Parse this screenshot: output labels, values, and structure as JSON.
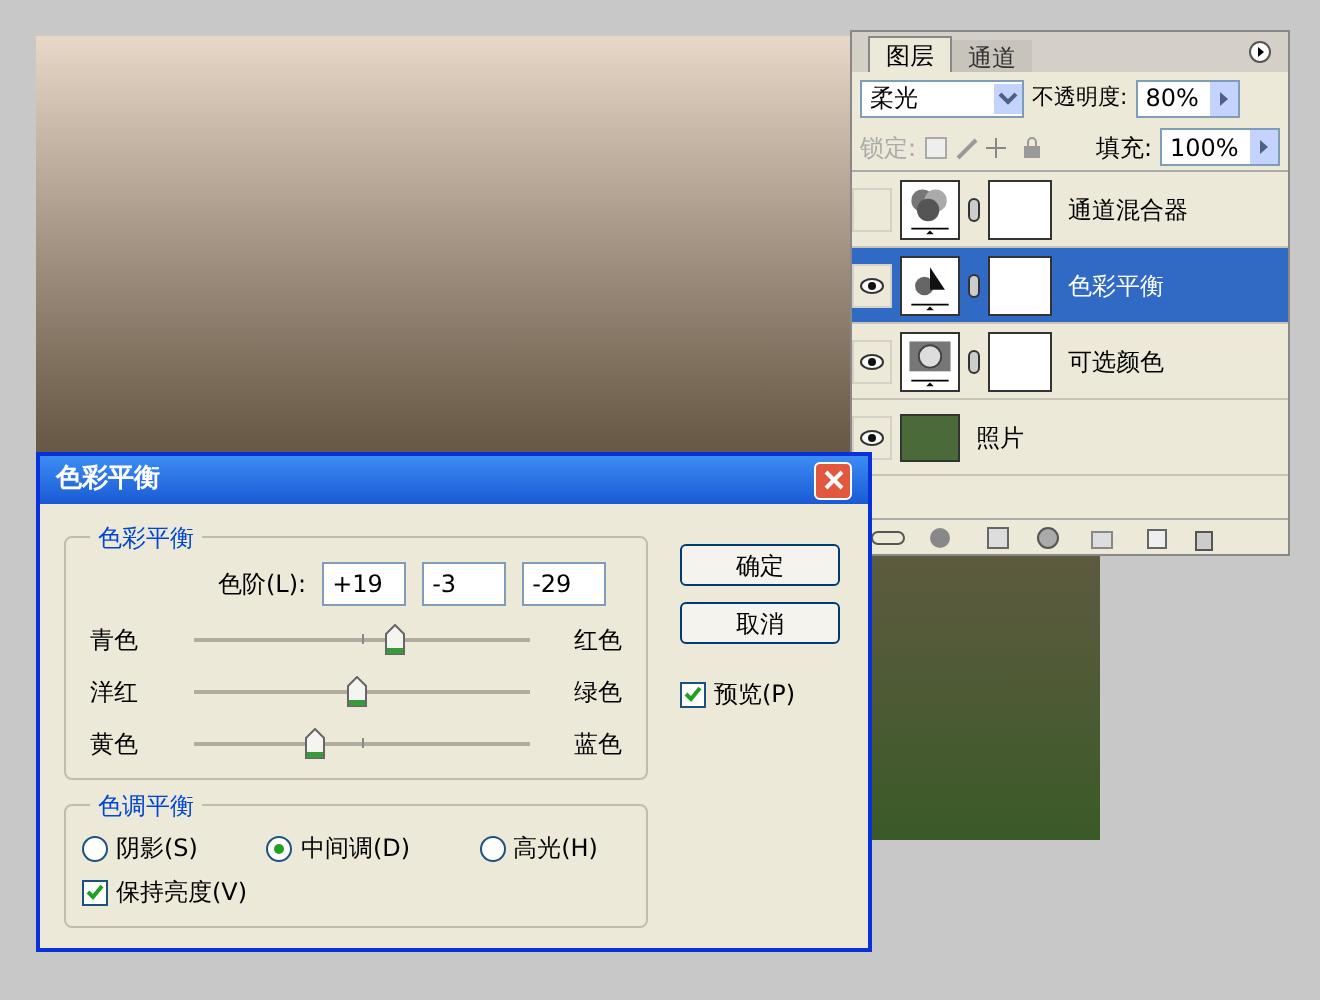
{
  "layers_panel": {
    "tabs": [
      {
        "label": "图层",
        "selected": true
      },
      {
        "label": "通道",
        "selected": false
      }
    ],
    "blend_mode": "柔光",
    "opacity_label": "不透明度:",
    "opacity": "80%",
    "lock_label": "锁定:",
    "fill_label": "填充:",
    "fill": "100%",
    "layers": [
      {
        "name": "通道混合器",
        "kind": "mixer",
        "visible": false,
        "selected": false
      },
      {
        "name": "色彩平衡",
        "kind": "balance",
        "visible": true,
        "selected": true
      },
      {
        "name": "可选颜色",
        "kind": "selective",
        "visible": true,
        "selected": false
      },
      {
        "name": "照片",
        "kind": "photo",
        "visible": true,
        "selected": false
      }
    ]
  },
  "dialog": {
    "title": "色彩平衡",
    "balance_group": "色彩平衡",
    "levels_label": "色阶(L):",
    "levels": [
      "+19",
      "-3",
      "-29"
    ],
    "sliders": [
      {
        "left": "青色",
        "right": "红色",
        "level": 0.595
      },
      {
        "left": "洋红",
        "right": "绿色",
        "level": 0.485
      },
      {
        "left": "黄色",
        "right": "蓝色",
        "level": 0.355
      }
    ],
    "tone_group": "色调平衡",
    "tones": [
      {
        "label": "阴影(S)",
        "selected": false
      },
      {
        "label": "中间调(D)",
        "selected": true
      },
      {
        "label": "高光(H)",
        "selected": false
      }
    ],
    "preserve": {
      "label": "保持亮度(V)",
      "checked": true
    },
    "buttons": [
      "确定",
      "取消"
    ],
    "preview": {
      "label": "预览(P)",
      "checked": true
    }
  }
}
